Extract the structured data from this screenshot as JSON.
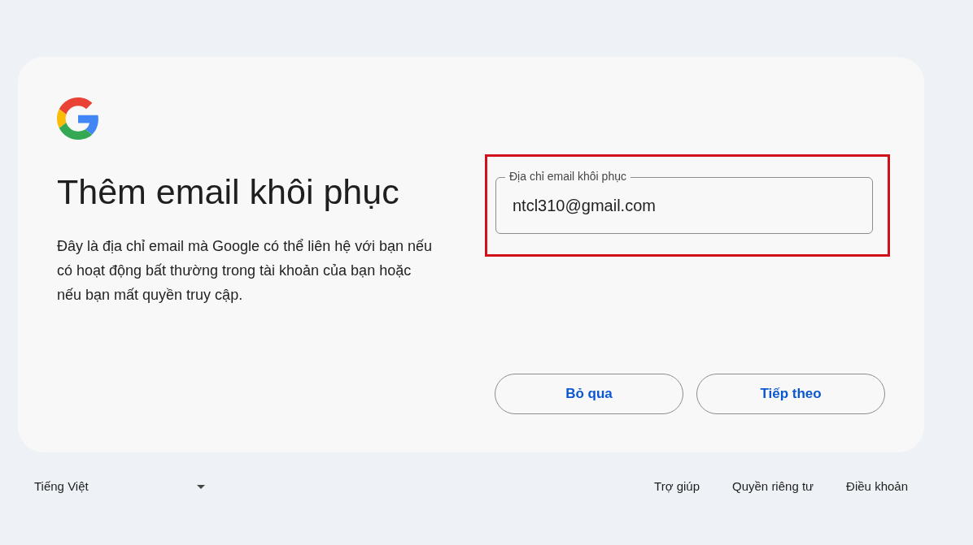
{
  "title": "Thêm email khôi phục",
  "description": "Đây là địa chỉ email mà Google có thể liên hệ với bạn nếu có hoạt động bất thường trong tài khoản của bạn hoặc nếu bạn mất quyền truy cập.",
  "field": {
    "label": "Địa chỉ email khôi phục",
    "value": "ntcl310@gmail.com",
    "highlighted": true
  },
  "buttons": [
    {
      "label": "Bỏ qua"
    },
    {
      "label": "Tiếp theo"
    }
  ],
  "footer": {
    "language": "Tiếng Việt",
    "links": [
      "Trợ giúp",
      "Quyền riêng tư",
      "Điều khoản"
    ]
  }
}
